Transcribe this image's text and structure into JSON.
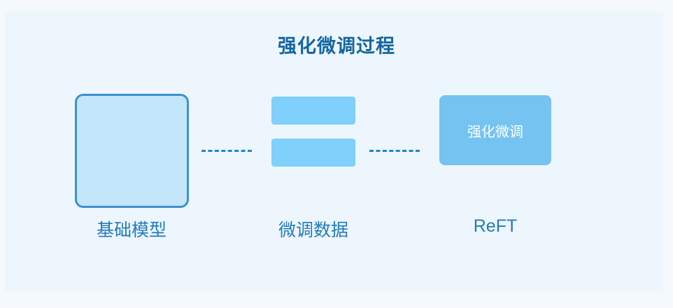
{
  "diagram": {
    "title": "强化微调过程",
    "nodes": [
      {
        "id": "base-model",
        "label": "基础模型"
      },
      {
        "id": "finetune-data",
        "label": "微调数据"
      },
      {
        "id": "reft",
        "label": "ReFT",
        "box_text": "强化微调"
      }
    ],
    "colors": {
      "title": "#1366a0",
      "base_fill": "#c3e6fb",
      "base_border": "#3b92cf",
      "data_bar": "#7fd0fa",
      "reft_fill": "#74c3f0",
      "connector": "#1f86c8",
      "label": "#1f7cbc",
      "background": "#eef6fd"
    }
  }
}
